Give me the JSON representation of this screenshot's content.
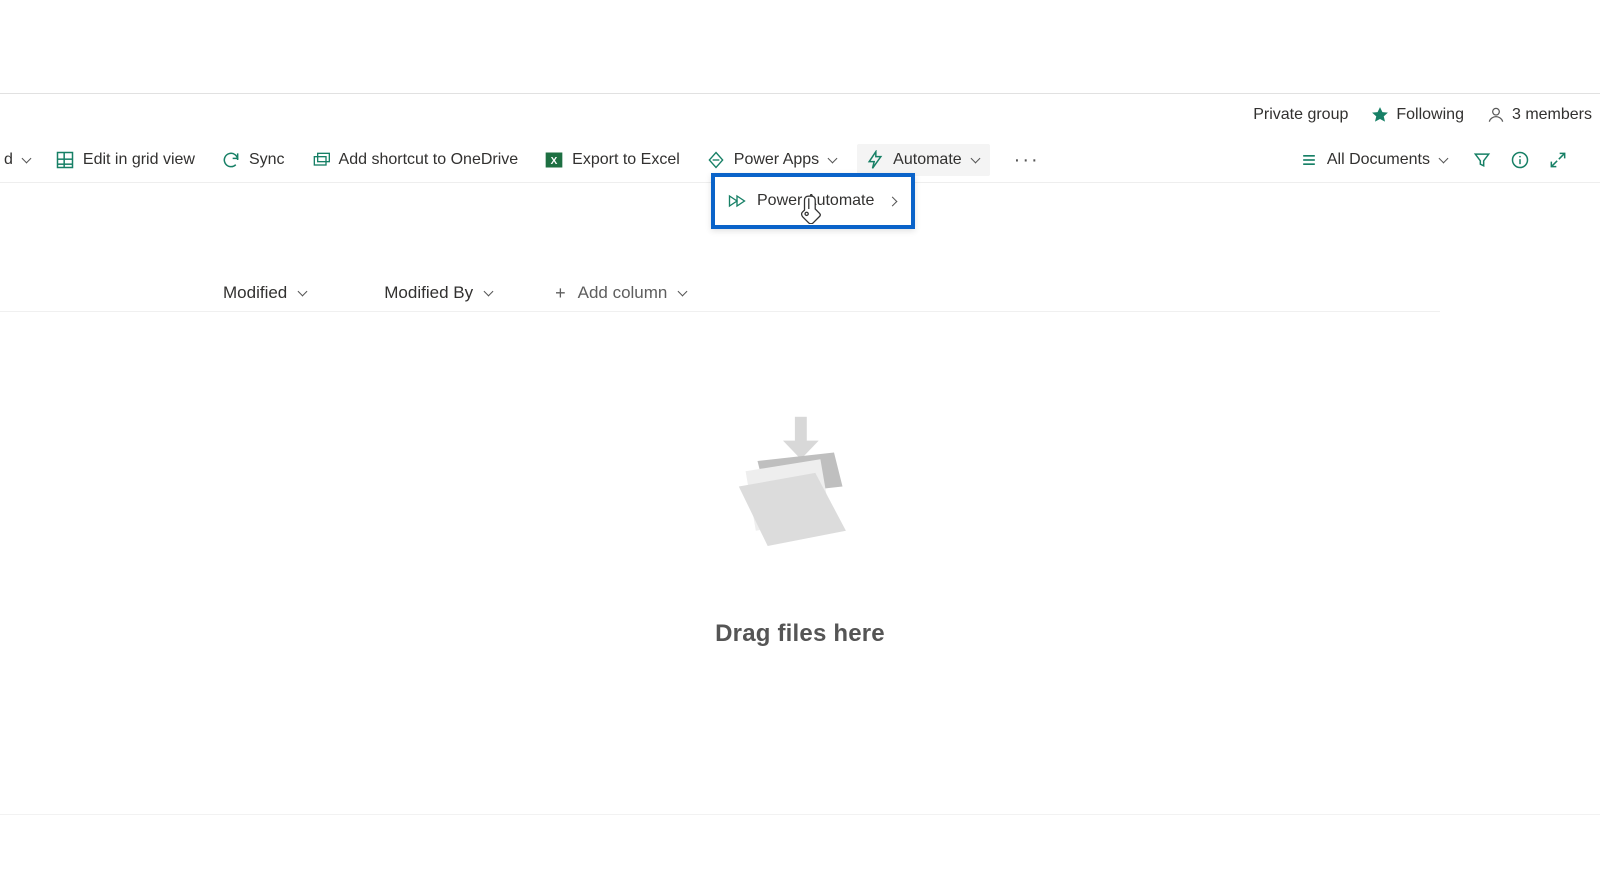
{
  "colors": {
    "teal": "#178066",
    "blue": "#0a63c9",
    "excel": "#1d6f42"
  },
  "header": {
    "private_group": "Private group",
    "following": "Following",
    "members": "3 members"
  },
  "toolbar": {
    "new_trunc": "d",
    "edit_grid": "Edit in grid view",
    "sync": "Sync",
    "shortcut": "Add shortcut to OneDrive",
    "export_excel": "Export to Excel",
    "power_apps": "Power Apps",
    "automate": "Automate",
    "all_documents": "All Documents"
  },
  "dropdown": {
    "power_automate": "Power Automate"
  },
  "columns": {
    "modified": "Modified",
    "modified_by": "Modified By",
    "add_column": "Add column"
  },
  "empty": {
    "drag_here": "Drag files here"
  }
}
